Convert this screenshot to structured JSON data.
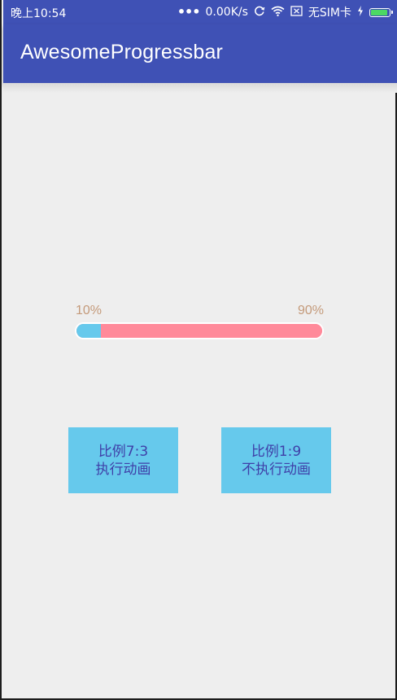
{
  "status_bar": {
    "time": "晚上10:54",
    "speed": "0.00K/s",
    "sim": "无SIM卡",
    "icons": [
      "more-dots-icon",
      "sync-icon",
      "wifi-icon",
      "no-sim-icon",
      "charging-icon",
      "battery-icon"
    ],
    "battery_color": "#4cd964"
  },
  "app_bar": {
    "title": "AwesomeProgressbar",
    "color": "#3f51b5"
  },
  "progress": {
    "left_label": "10%",
    "right_label": "90%",
    "left_fraction": 0.1,
    "right_fraction": 0.9,
    "left_color": "#66c9ec",
    "right_color": "#ff8a9a"
  },
  "buttons": [
    {
      "line1": "比例7:3",
      "line2": "执行动画"
    },
    {
      "line1": "比例1:9",
      "line2": "不执行动画"
    }
  ],
  "colors": {
    "background": "#eeeeee",
    "button_bg": "#66c9ec",
    "button_text": "#3f3fa8",
    "label_text": "#c49a7a"
  }
}
